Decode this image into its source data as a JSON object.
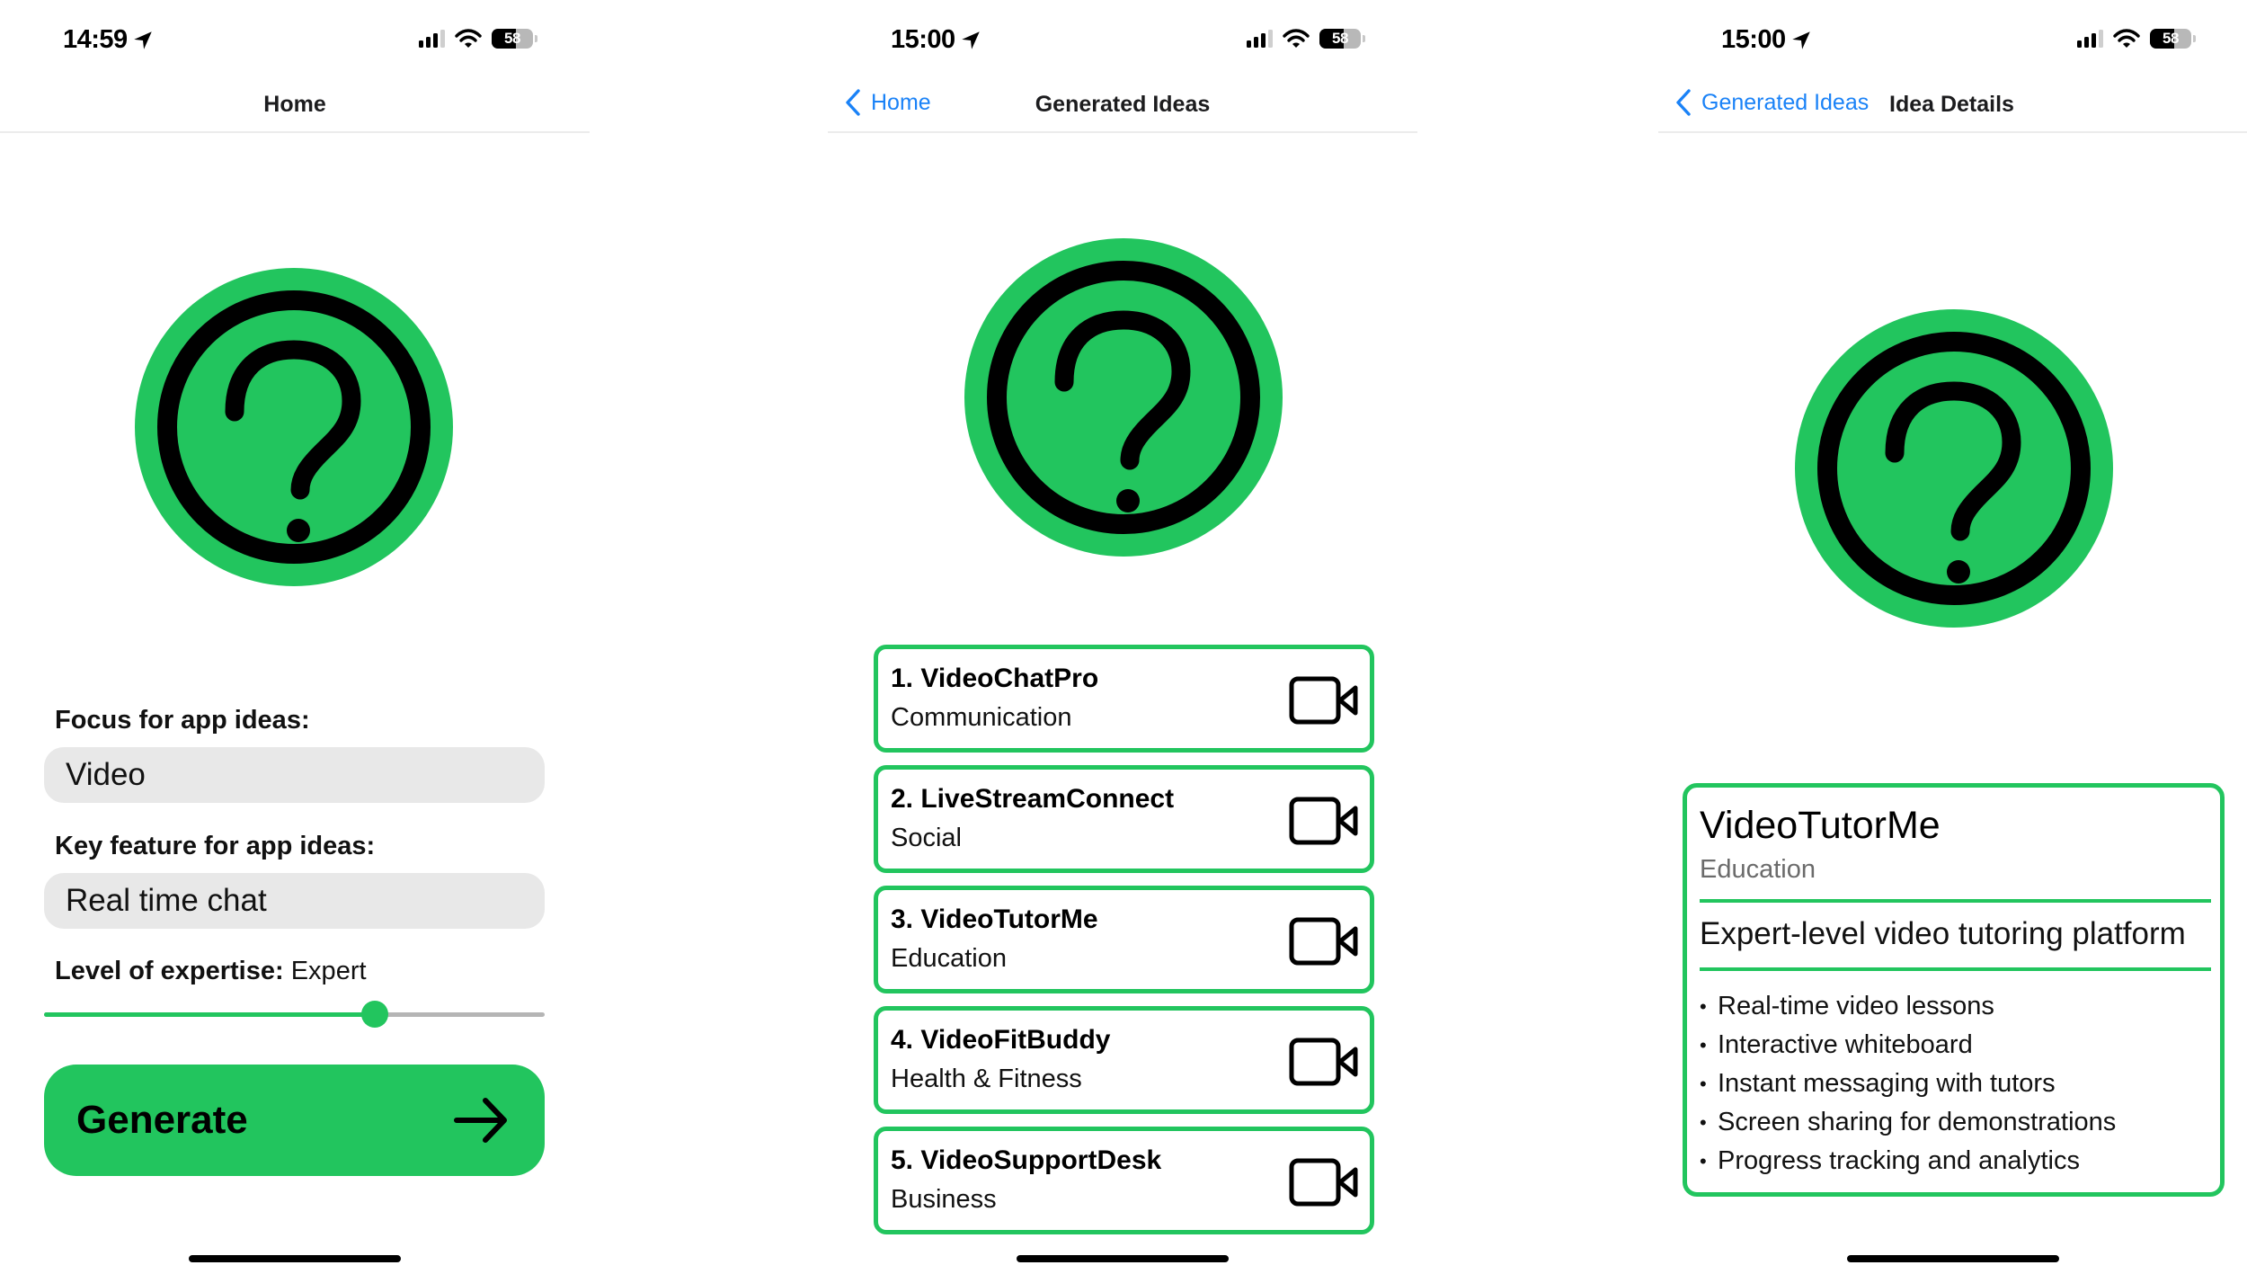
{
  "colors": {
    "accent": "#22c55e",
    "link": "#1a82f7",
    "field_bg": "#e8e8e8",
    "secondary_text": "#6b6b6b"
  },
  "screens": [
    {
      "status": {
        "time": "14:59",
        "battery": "58",
        "battery_level": 0.58
      },
      "nav": {
        "title": "Home"
      },
      "icon": "question-circle-icon",
      "form": {
        "focus_label": "Focus for app ideas:",
        "focus_value": "Video",
        "feature_label": "Key feature for app ideas:",
        "feature_value": "Real time chat",
        "expertise_label": "Level of expertise:",
        "expertise_value": "Expert",
        "expertise_slider_fraction": 0.66
      },
      "generate_button": {
        "label": "Generate",
        "icon": "arrow-right-icon"
      }
    },
    {
      "status": {
        "time": "15:00",
        "battery": "58",
        "battery_level": 0.58
      },
      "nav": {
        "back_label": "Home",
        "title": "Generated Ideas"
      },
      "icon": "question-circle-icon",
      "ideas": [
        {
          "title": "1. VideoChatPro",
          "category": "Communication",
          "icon": "video-camera-icon"
        },
        {
          "title": "2. LiveStreamConnect",
          "category": "Social",
          "icon": "video-camera-icon"
        },
        {
          "title": "3. VideoTutorMe",
          "category": "Education",
          "icon": "video-camera-icon"
        },
        {
          "title": "4. VideoFitBuddy",
          "category": "Health & Fitness",
          "icon": "video-camera-icon"
        },
        {
          "title": "5. VideoSupportDesk",
          "category": "Business",
          "icon": "video-camera-icon"
        }
      ]
    },
    {
      "status": {
        "time": "15:00",
        "battery": "58",
        "battery_level": 0.58
      },
      "nav": {
        "back_label": "Generated Ideas",
        "title": "Idea Details"
      },
      "icon": "question-circle-icon",
      "detail": {
        "name": "VideoTutorMe",
        "category": "Education",
        "description": "Expert-level video tutoring platform",
        "bullet": "•",
        "features": [
          "Real-time video lessons",
          "Interactive whiteboard",
          "Instant messaging with tutors",
          "Screen sharing for demonstrations",
          "Progress tracking and analytics"
        ]
      }
    }
  ]
}
